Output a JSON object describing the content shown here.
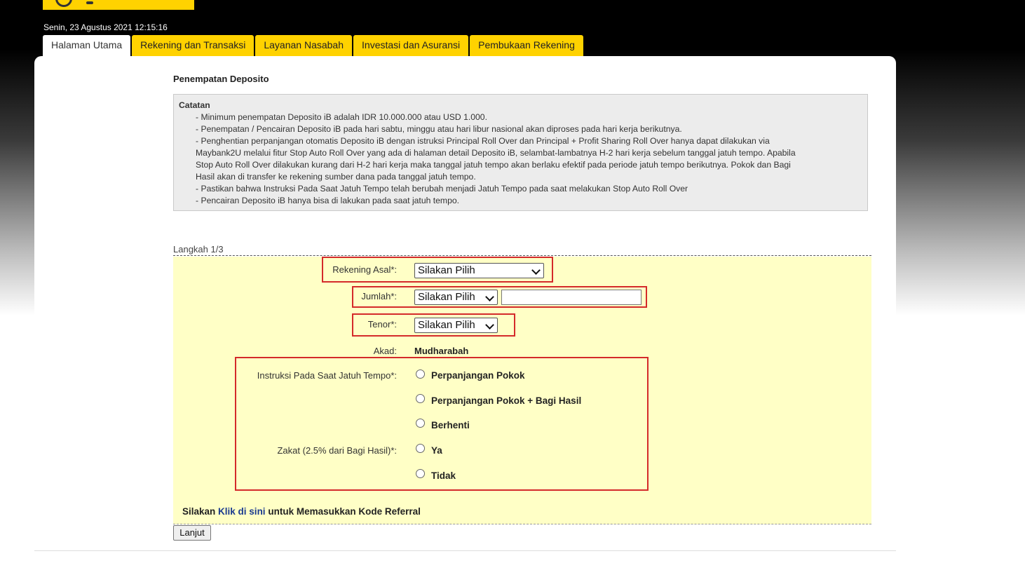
{
  "header": {
    "datetime": "Senin, 23 Agustus 2021 12:15:16",
    "brand_color": "#ffd200"
  },
  "tabs": [
    {
      "label": "Halaman Utama",
      "active": true
    },
    {
      "label": "Rekening dan Transaksi",
      "active": false
    },
    {
      "label": "Layanan Nasabah",
      "active": false
    },
    {
      "label": "Investasi dan Asuransi",
      "active": false
    },
    {
      "label": "Pembukaan Rekening",
      "active": false
    }
  ],
  "page": {
    "title": "Penempatan Deposito"
  },
  "notes": {
    "title": "Catatan",
    "lines": [
      "- Minimum penempatan Deposito iB adalah IDR 10.000.000 atau USD 1.000.",
      "- Penempatan / Pencairan Deposito iB pada hari sabtu, minggu atau hari libur nasional akan diproses pada hari kerja berikutnya.",
      "- Penghentian perpanjangan otomatis Deposito iB dengan istruksi Principal Roll Over dan Principal + Profit Sharing Roll Over hanya dapat dilakukan via",
      "Maybank2U melalui fitur Stop Auto Roll Over yang ada di halaman detail Deposito iB, selambat-lambatnya H-2 hari kerja sebelum tanggal jatuh tempo. Apabila",
      "Stop Auto Roll Over dilakukan kurang dari H-2 hari kerja maka tanggal jatuh tempo akan berlaku efektif pada periode jatuh tempo berikutnya. Pokok dan Bagi",
      "Hasil akan di transfer ke rekening sumber dana pada tanggal jatuh tempo.",
      "- Pastikan bahwa Instruksi Pada Saat Jatuh Tempo telah berubah menjadi Jatuh Tempo pada saat melakukan Stop Auto Roll Over",
      "- Pencairan Deposito iB hanya bisa di lakukan pada saat jatuh tempo."
    ]
  },
  "form": {
    "step": "Langkah 1/3",
    "rekening_label": "Rekening Asal*:",
    "rekening_value": "Silakan Pilih",
    "jumlah_label": "Jumlah*:",
    "jumlah_currency": "Silakan Pilih",
    "jumlah_amount": "",
    "tenor_label": "Tenor*:",
    "tenor_value": "Silakan Pilih",
    "akad_label": "Akad:",
    "akad_value": "Mudharabah",
    "instruksi_label": "Instruksi Pada Saat Jatuh Tempo*:",
    "instruksi_options": [
      "Perpanjangan Pokok",
      "Perpanjangan Pokok + Bagi Hasil",
      "Berhenti"
    ],
    "zakat_label": "Zakat (2.5% dari Bagi Hasil)*:",
    "zakat_options": [
      "Ya",
      "Tidak"
    ],
    "referral_prefix": "Silakan",
    "referral_link": "Klik di sini",
    "referral_suffix": "untuk Memasukkan Kode Referral",
    "submit_label": "Lanjut",
    "highlight_color": "#d42a2a",
    "form_bg": "#ffffc6"
  }
}
